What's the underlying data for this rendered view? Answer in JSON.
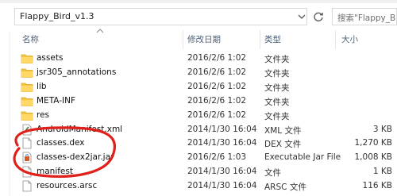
{
  "address": {
    "path": "Flappy_Bird_v1.3"
  },
  "search": {
    "placeholder": "搜索\"Flappy_Bir"
  },
  "columns": {
    "name": "名称",
    "date": "修改日期",
    "type": "类型",
    "size": "大小"
  },
  "files": [
    {
      "name": "assets",
      "date": "2016/2/6 1:02",
      "type": "文件夹",
      "size": "",
      "icon": "folder-icon"
    },
    {
      "name": "jsr305_annotations",
      "date": "2016/2/6 1:02",
      "type": "文件夹",
      "size": "",
      "icon": "folder-icon"
    },
    {
      "name": "lib",
      "date": "2016/2/6 1:02",
      "type": "文件夹",
      "size": "",
      "icon": "folder-icon"
    },
    {
      "name": "META-INF",
      "date": "2016/2/6 1:02",
      "type": "文件夹",
      "size": "",
      "icon": "folder-icon"
    },
    {
      "name": "res",
      "date": "2016/2/6 1:02",
      "type": "文件夹",
      "size": "",
      "icon": "folder-icon"
    },
    {
      "name": "AndroidManifest.xml",
      "date": "2014/1/30 16:04",
      "type": "XML 文件",
      "size": "3 KB",
      "icon": "xml-file-icon"
    },
    {
      "name": "classes.dex",
      "date": "2014/1/30 16:04",
      "type": "DEX 文件",
      "size": "1,270 KB",
      "icon": "file-icon"
    },
    {
      "name": "classes-dex2jar.jar",
      "date": "2016/2/6 1:03",
      "type": "Executable Jar File",
      "size": "1,008 KB",
      "icon": "jar-file-icon"
    },
    {
      "name": "manifest",
      "date": "2014/1/30 16:04",
      "type": "文件",
      "size": "1 KB",
      "icon": "file-icon"
    },
    {
      "name": "resources.arsc",
      "date": "2014/1/30 16:04",
      "type": "ARSC 文件",
      "size": "116 KB",
      "icon": "file-icon"
    }
  ],
  "colors": {
    "folder": "#f5c542",
    "selection": "#cce8ff",
    "annotation": "#e0201b",
    "header_text": "#4c607a"
  }
}
